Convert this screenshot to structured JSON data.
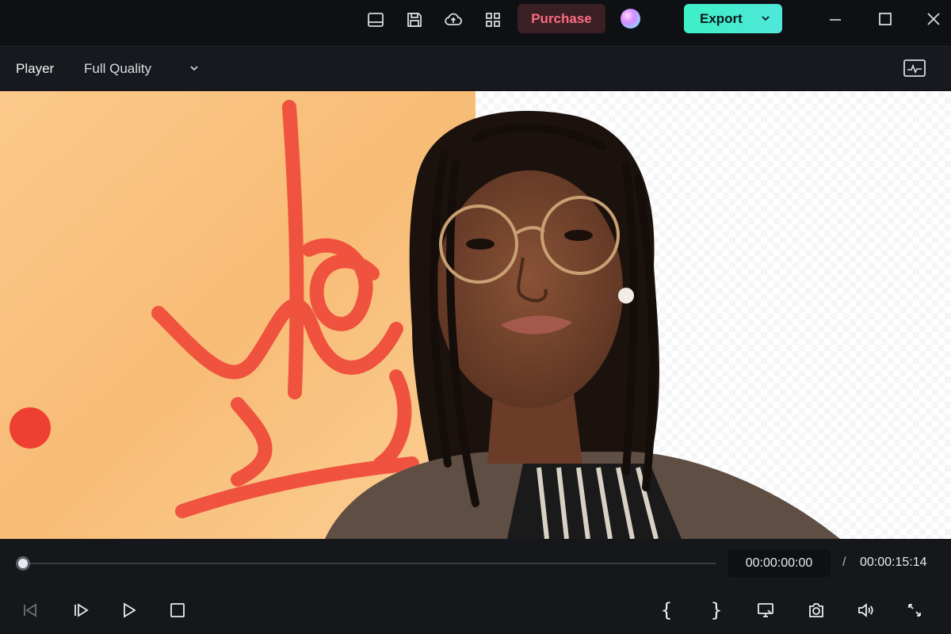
{
  "titlebar": {
    "icons": [
      "layout-icon",
      "save-icon",
      "cloud-upload-icon",
      "apps-grid-icon"
    ],
    "purchase_label": "Purchase",
    "export_label": "Export",
    "window_controls": [
      "minimize-icon",
      "maximize-icon",
      "close-icon"
    ]
  },
  "player": {
    "title": "Player",
    "quality": "Full Quality",
    "scopes_icon": "scopes-icon"
  },
  "colors": {
    "accent_export": "#3ef0c8",
    "purchase_text": "#ff6b83",
    "background": "#0f1115"
  },
  "playback": {
    "current_time": "00:00:00:00",
    "separator": "/",
    "total_time": "00:00:15:14",
    "progress": 0
  },
  "controls": {
    "left": [
      "prev-frame-icon",
      "next-frame-icon",
      "play-icon",
      "stop-icon"
    ],
    "mark_in": "{",
    "mark_out": "}",
    "right": [
      "display-icon",
      "snapshot-icon",
      "volume-icon",
      "fullscreen-icon"
    ]
  }
}
